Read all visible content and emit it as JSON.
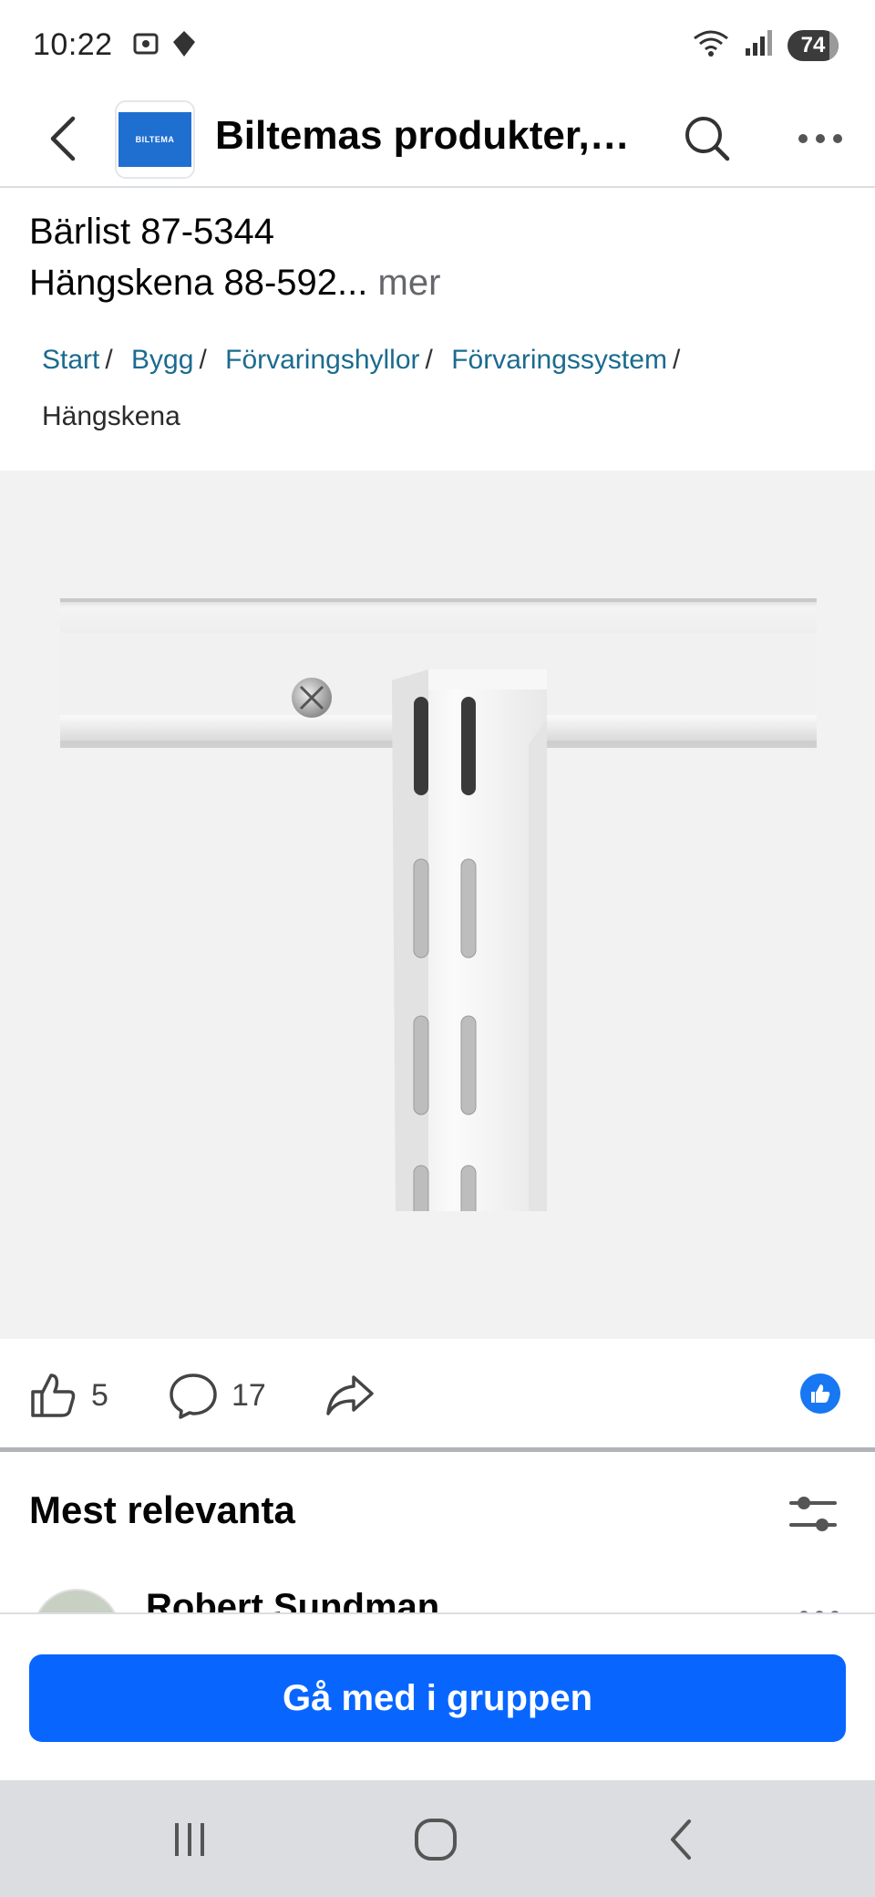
{
  "status_bar": {
    "time": "10:22",
    "battery": "74",
    "icons": [
      "screenshot-icon",
      "location-icon",
      "wifi-icon",
      "signal-icon",
      "battery-icon"
    ]
  },
  "app_bar": {
    "group_title": "Biltemas produkter, r...",
    "logo_text": "BILTEMA",
    "icons": [
      "back-arrow-icon",
      "search-icon",
      "more-icon"
    ]
  },
  "post": {
    "line1": "Bärlist 87-5344",
    "line2": "Hängskena 88-592...",
    "more_label": "mer"
  },
  "breadcrumb": {
    "items": [
      "Start",
      "Bygg",
      "Förvaringshyllor",
      "Förvaringssystem"
    ],
    "separator": "/",
    "current": "Hängskena"
  },
  "actions": {
    "like_count": "5",
    "comment_count": "17",
    "share_icon": "share-icon"
  },
  "comments": {
    "header": "Mest relevanta",
    "first_commenter": "Robert Sundman"
  },
  "join": {
    "button_label": "Gå med i gruppen"
  },
  "colors": {
    "accent_blue": "#0866ff",
    "link_teal": "#1b6b8f",
    "image_background": "#f2f2f2"
  }
}
